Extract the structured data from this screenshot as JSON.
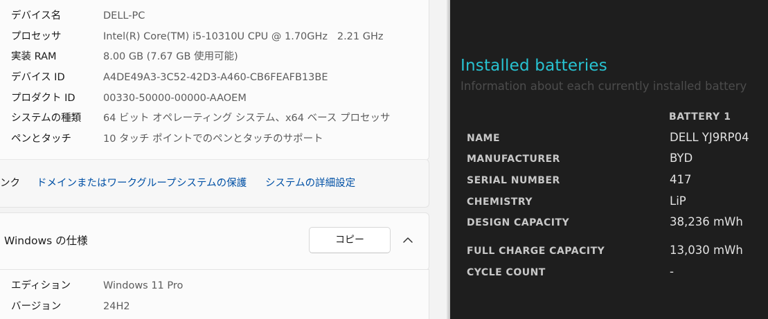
{
  "settings": {
    "specs": [
      {
        "label": "デバイス名",
        "value": "DELL-PC"
      },
      {
        "label": "プロセッサ",
        "value": "Intel(R) Core(TM) i5-10310U CPU @ 1.70GHz   2.21 GHz"
      },
      {
        "label": "実装 RAM",
        "value": "8.00 GB (7.67 GB 使用可能)"
      },
      {
        "label": "デバイス ID",
        "value": "A4DE49A3-3C52-42D3-A460-CB6FEAFB13BE"
      },
      {
        "label": "プロダクト ID",
        "value": "00330-50000-00000-AAOEM"
      },
      {
        "label": "システムの種類",
        "value": "64 ビット オペレーティング システム、x64 ベース プロセッサ"
      },
      {
        "label": "ペンとタッチ",
        "value": "10 タッチ ポイントでのペンとタッチのサポート"
      }
    ],
    "links": {
      "lead": "ンク",
      "items": [
        "ドメインまたはワークグループ",
        "システムの保護",
        "システムの詳細設定"
      ]
    },
    "windows_spec": {
      "title": "Windows の仕様",
      "copy_label": "コピー",
      "rows": [
        {
          "label": "エディション",
          "value": "Windows 11 Pro"
        },
        {
          "label": "バージョン",
          "value": "24H2"
        }
      ]
    }
  },
  "battery_report": {
    "title": "Installed batteries",
    "subtitle": "Information about each currently installed battery",
    "column_header": "BATTERY 1",
    "rows": [
      {
        "label": "NAME",
        "value": "DELL YJ9RP04"
      },
      {
        "label": "MANUFACTURER",
        "value": "BYD"
      },
      {
        "label": "SERIAL NUMBER",
        "value": "417"
      },
      {
        "label": "CHEMISTRY",
        "value": "LiP"
      },
      {
        "label": "DESIGN CAPACITY",
        "value": "38,236 mWh"
      },
      {
        "label": "FULL CHARGE CAPACITY",
        "value": "13,030 mWh"
      },
      {
        "label": "CYCLE COUNT",
        "value": "-"
      }
    ]
  },
  "colors": {
    "accent_cyan": "#28c3d2",
    "link_blue": "#0050a5",
    "dark_bg": "#1e1e1e",
    "light_bg": "#f3f3f3"
  }
}
